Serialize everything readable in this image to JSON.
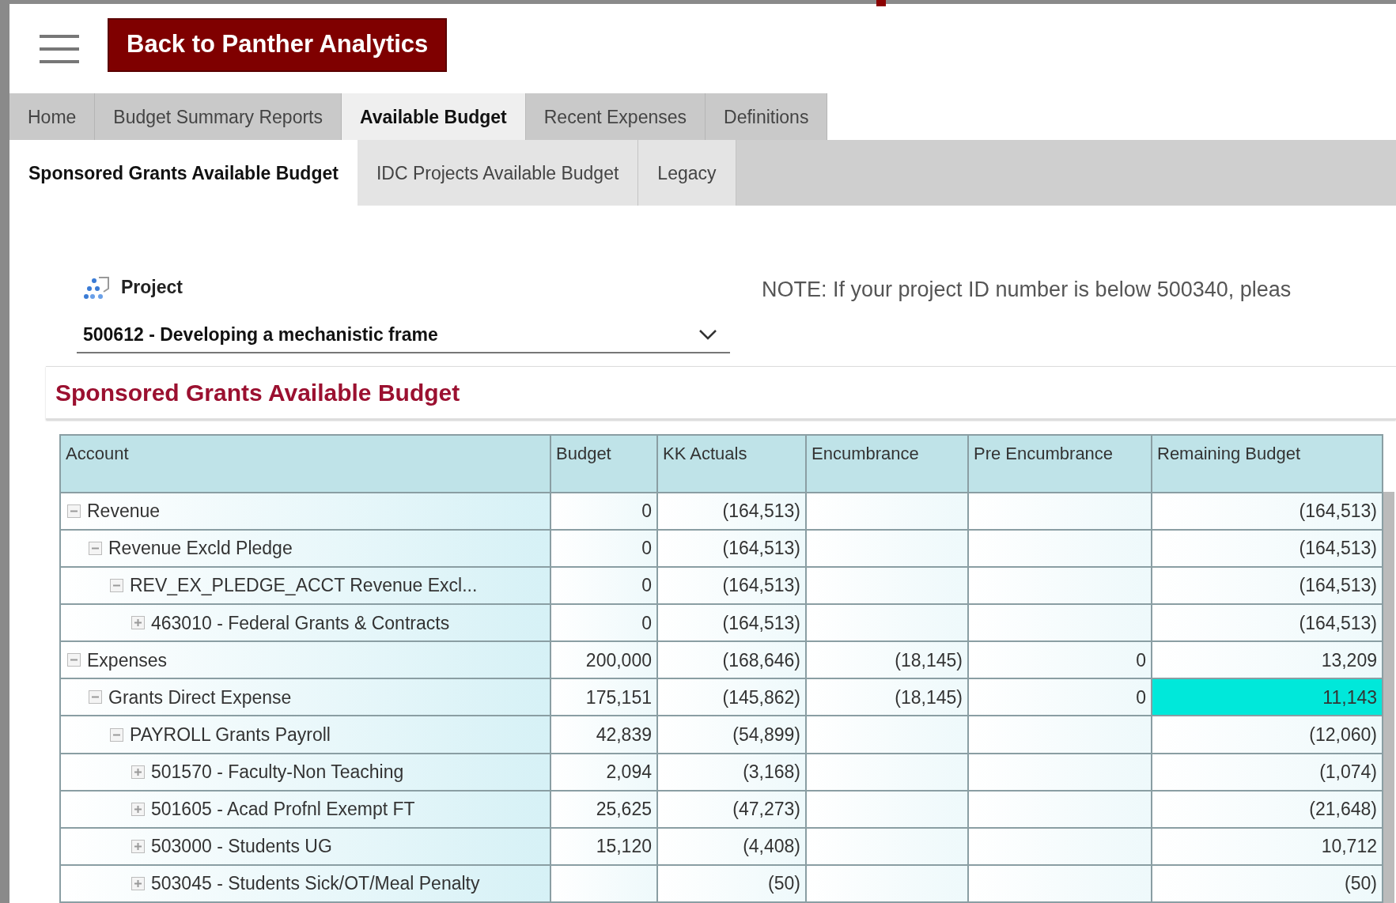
{
  "header": {
    "back_button": "Back to Panther Analytics"
  },
  "tabs": [
    {
      "label": "Home",
      "selected": false
    },
    {
      "label": "Budget Summary Reports",
      "selected": false
    },
    {
      "label": "Available Budget",
      "selected": true
    },
    {
      "label": "Recent Expenses",
      "selected": false
    },
    {
      "label": "Definitions",
      "selected": false
    }
  ],
  "subtabs": [
    {
      "label": "Sponsored Grants Available Budget",
      "selected": true
    },
    {
      "label": "IDC Projects Available Budget",
      "selected": false
    },
    {
      "label": "Legacy",
      "selected": false
    }
  ],
  "project_filter": {
    "label": "Project",
    "value": "500612 - Developing a mechanistic frame"
  },
  "note": "NOTE: If your project ID number is below 500340, pleas",
  "report": {
    "title": "Sponsored Grants Available Budget",
    "columns": [
      "Account",
      "Budget",
      "KK Actuals",
      "Encumbrance",
      "Pre Encumbrance",
      "Remaining Budget"
    ],
    "rows": [
      {
        "account": "Revenue",
        "expanded": true,
        "budget": "0",
        "kk_actuals": "(164,513)",
        "remaining_budget": "(164,513)",
        "highlighted": false,
        "children": [
          {
            "account": "Revenue Excld Pledge",
            "expanded": true,
            "budget": "0",
            "kk_actuals": "(164,513)",
            "remaining_budget": "(164,513)",
            "highlighted": false,
            "children": [
              {
                "account": "REV_EX_PLEDGE_ACCT Revenue Excl...",
                "expanded": true,
                "budget": "0",
                "kk_actuals": "(164,513)",
                "remaining_budget": "(164,513)",
                "highlighted": false,
                "children": [
                  {
                    "account": "463010 - Federal Grants & Contracts",
                    "expanded": false,
                    "budget": "0",
                    "kk_actuals": "(164,513)",
                    "remaining_budget": "(164,513)",
                    "highlighted": false
                  }
                ]
              }
            ]
          }
        ]
      },
      {
        "account": "Expenses",
        "expanded": true,
        "budget": "200,000",
        "kk_actuals": "(168,646)",
        "encumbrance": "(18,145)",
        "pre_encumbrance": "0",
        "remaining_budget": "13,209",
        "highlighted": false,
        "children": [
          {
            "account": "Grants Direct Expense",
            "expanded": true,
            "budget": "175,151",
            "kk_actuals": "(145,862)",
            "encumbrance": "(18,145)",
            "pre_encumbrance": "0",
            "remaining_budget": "11,143",
            "highlighted": true,
            "children": [
              {
                "account": "PAYROLL Grants Payroll",
                "expanded": true,
                "budget": "42,839",
                "kk_actuals": "(54,899)",
                "remaining_budget": "(12,060)",
                "highlighted": false,
                "children": [
                  {
                    "account": "501570 - Faculty-Non Teaching",
                    "expanded": false,
                    "budget": "2,094",
                    "kk_actuals": "(3,168)",
                    "remaining_budget": "(1,074)",
                    "highlighted": false
                  },
                  {
                    "account": "501605 - Acad Profnl Exempt FT",
                    "expanded": false,
                    "budget": "25,625",
                    "kk_actuals": "(47,273)",
                    "remaining_budget": "(21,648)",
                    "highlighted": false
                  },
                  {
                    "account": "503000 - Students UG",
                    "expanded": false,
                    "budget": "15,120",
                    "kk_actuals": "(4,408)",
                    "remaining_budget": "10,712",
                    "highlighted": false
                  },
                  {
                    "account": "503045 - Students Sick/OT/Meal Penalty",
                    "expanded": false,
                    "kk_actuals": "(50)",
                    "remaining_budget": "(50)",
                    "highlighted": false
                  }
                ]
              }
            ]
          }
        ]
      }
    ]
  }
}
